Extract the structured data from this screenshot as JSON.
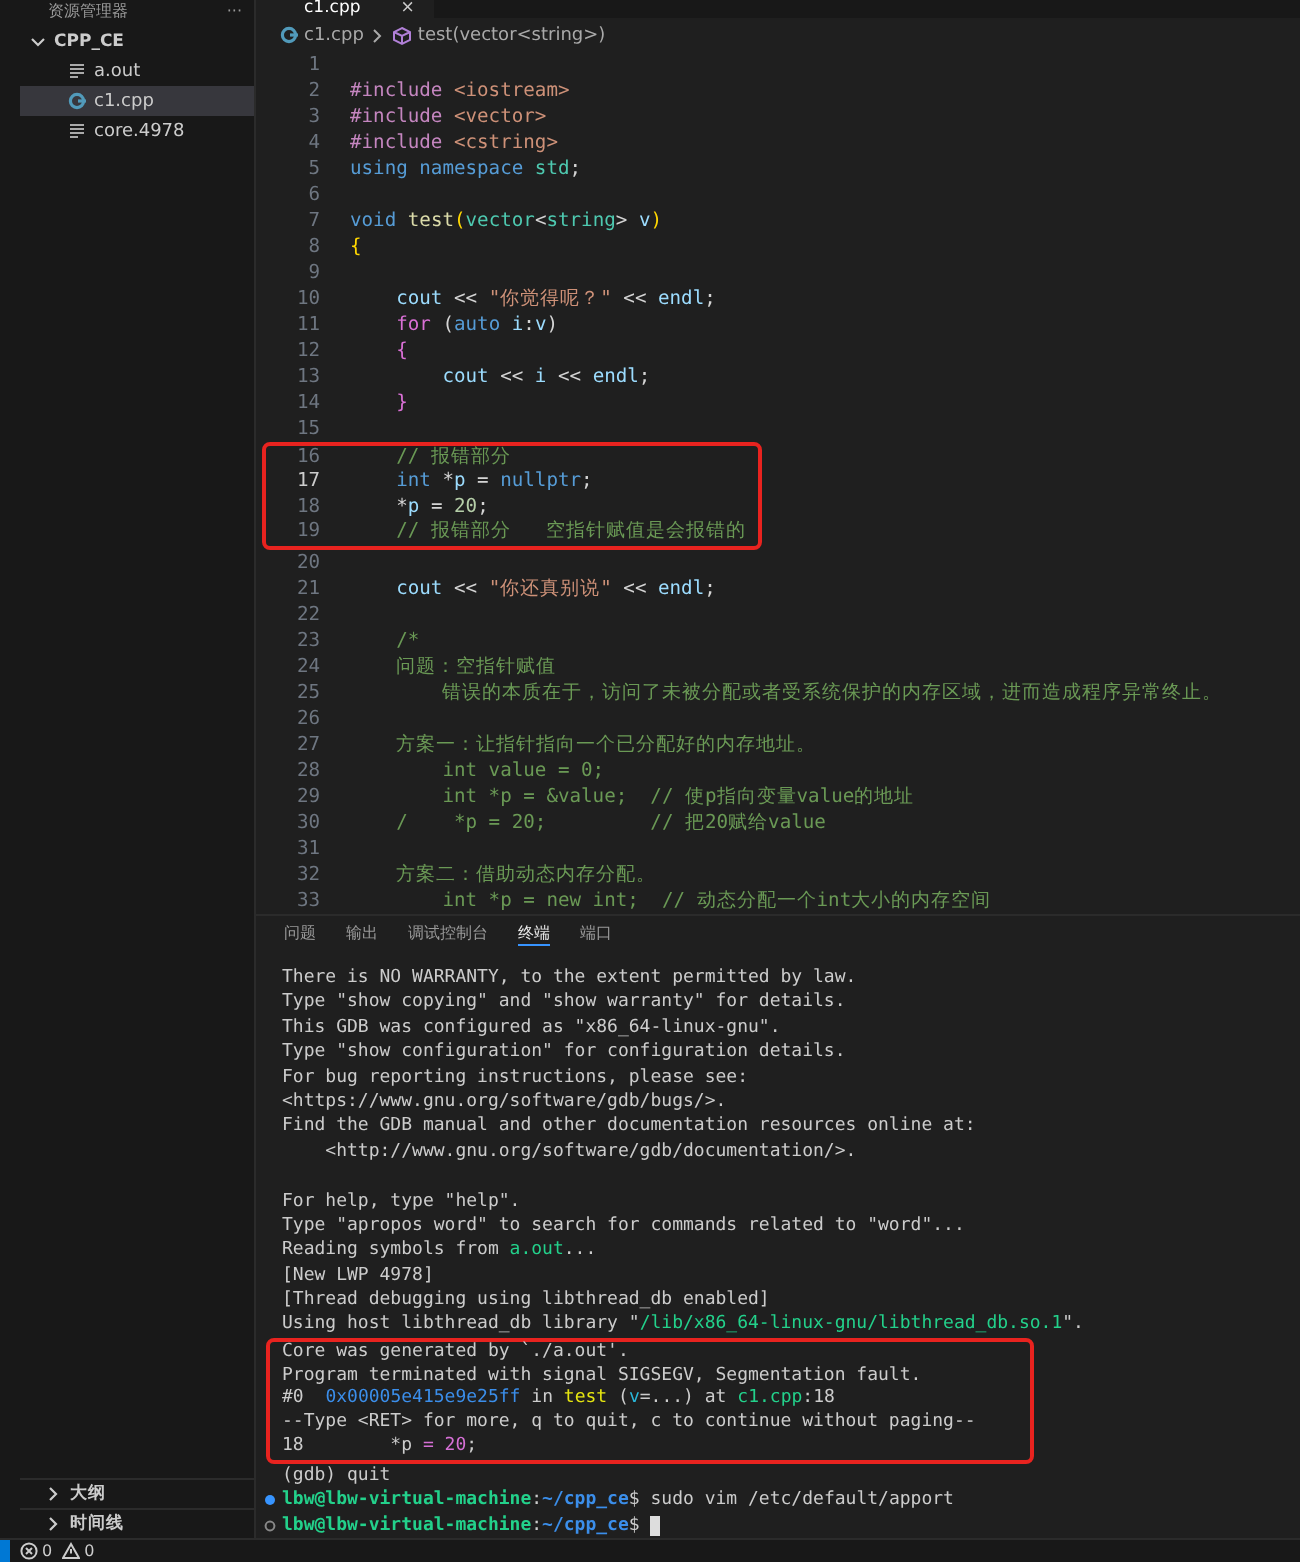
{
  "sidebar": {
    "title": "资源管理器",
    "more": "···",
    "folder": {
      "label": "CPP_CE",
      "expanded": true,
      "children": [
        {
          "label": "a.out",
          "kind": "text",
          "selected": false
        },
        {
          "label": "c1.cpp",
          "kind": "cpp",
          "selected": true
        },
        {
          "label": "core.4978",
          "kind": "text",
          "selected": false
        }
      ]
    },
    "sections": [
      {
        "label": "大纲",
        "expanded": false
      },
      {
        "label": "时间线",
        "expanded": false
      }
    ]
  },
  "editor": {
    "tabs": [
      {
        "label": "c1.cpp",
        "close": "×",
        "selected": true
      }
    ],
    "breadcrumb": [
      {
        "label": "c1.cpp",
        "kind": "file"
      },
      {
        "label": "test(vector<string>)",
        "kind": "function"
      }
    ],
    "lines": [
      {
        "number": "1",
        "boxed": false,
        "current": false
      },
      {
        "number": "2",
        "boxed": false,
        "current": false,
        "tokens": [
          {
            "kind": "macro",
            "text": "#include "
          },
          {
            "kind": "str",
            "text": "<iostream>"
          }
        ]
      },
      {
        "number": "3",
        "boxed": false,
        "current": false,
        "tokens": [
          {
            "kind": "macro",
            "text": "#include "
          },
          {
            "kind": "str",
            "text": "<vector>"
          }
        ]
      },
      {
        "number": "4",
        "boxed": false,
        "current": false,
        "tokens": [
          {
            "kind": "macro",
            "text": "#include "
          },
          {
            "kind": "str",
            "text": "<cstring>"
          }
        ]
      },
      {
        "number": "5",
        "boxed": false,
        "current": false,
        "tokens": [
          {
            "kind": "kw",
            "text": "using "
          },
          {
            "kind": "kw",
            "text": "namespace "
          },
          {
            "kind": "type",
            "text": "std"
          },
          {
            "kind": "plain",
            "text": ";"
          }
        ]
      },
      {
        "number": "6",
        "boxed": false,
        "current": false
      },
      {
        "number": "7",
        "boxed": false,
        "current": false,
        "tokens": [
          {
            "kind": "kw",
            "text": "void "
          },
          {
            "kind": "fn",
            "text": "test"
          },
          {
            "kind": "brace",
            "text": "("
          },
          {
            "kind": "type",
            "text": "vector"
          },
          {
            "kind": "plain",
            "text": "<"
          },
          {
            "kind": "type",
            "text": "string"
          },
          {
            "kind": "plain",
            "text": "> "
          },
          {
            "kind": "var",
            "text": "v"
          },
          {
            "kind": "brace",
            "text": ")"
          }
        ]
      },
      {
        "number": "8",
        "boxed": false,
        "current": false,
        "tokens": [
          {
            "kind": "brace",
            "text": "{"
          }
        ]
      },
      {
        "number": "9",
        "boxed": false,
        "current": false
      },
      {
        "number": "10",
        "boxed": false,
        "current": false,
        "tokens": [
          {
            "kind": "var",
            "text": "    cout"
          },
          {
            "kind": "plain",
            "text": " << "
          },
          {
            "kind": "str",
            "text": "\"你觉得呢？\""
          },
          {
            "kind": "plain",
            "text": " << "
          },
          {
            "kind": "var",
            "text": "endl"
          },
          {
            "kind": "plain",
            "text": ";"
          }
        ]
      },
      {
        "number": "11",
        "boxed": false,
        "current": false,
        "tokens": [
          {
            "kind": "ctrl",
            "text": "    for"
          },
          {
            "kind": "plain",
            "text": " ("
          },
          {
            "kind": "kw",
            "text": "auto "
          },
          {
            "kind": "var",
            "text": "i"
          },
          {
            "kind": "plain",
            "text": ":"
          },
          {
            "kind": "var",
            "text": "v"
          },
          {
            "kind": "plain",
            "text": ")"
          }
        ]
      },
      {
        "number": "12",
        "boxed": false,
        "current": false,
        "tokens": [
          {
            "kind": "ctrl",
            "text": "    {"
          }
        ]
      },
      {
        "number": "13",
        "boxed": false,
        "current": false,
        "tokens": [
          {
            "kind": "var",
            "text": "        cout"
          },
          {
            "kind": "plain",
            "text": " << "
          },
          {
            "kind": "var",
            "text": "i"
          },
          {
            "kind": "plain",
            "text": " << "
          },
          {
            "kind": "var",
            "text": "endl"
          },
          {
            "kind": "plain",
            "text": ";"
          }
        ]
      },
      {
        "number": "14",
        "boxed": false,
        "current": false,
        "tokens": [
          {
            "kind": "ctrl",
            "text": "    }"
          }
        ]
      },
      {
        "number": "15",
        "boxed": false,
        "current": false
      },
      {
        "number": "16",
        "boxed": true,
        "current": false,
        "tokens": [
          {
            "kind": "cmt",
            "text": "    // 报错部分"
          }
        ]
      },
      {
        "number": "17",
        "boxed": true,
        "current": true,
        "tokens": [
          {
            "kind": "kw",
            "text": "    int"
          },
          {
            "kind": "plain",
            "text": " *"
          },
          {
            "kind": "var",
            "text": "p"
          },
          {
            "kind": "plain",
            "text": " = "
          },
          {
            "kind": "kw",
            "text": "nullptr"
          },
          {
            "kind": "plain",
            "text": ";"
          }
        ]
      },
      {
        "number": "18",
        "boxed": true,
        "current": false,
        "tokens": [
          {
            "kind": "plain",
            "text": "    *"
          },
          {
            "kind": "var",
            "text": "p"
          },
          {
            "kind": "plain",
            "text": " = "
          },
          {
            "kind": "num",
            "text": "20"
          },
          {
            "kind": "plain",
            "text": ";"
          }
        ]
      },
      {
        "number": "19",
        "boxed": true,
        "current": false,
        "tokens": [
          {
            "kind": "cmt",
            "text": "    // 报错部分   空指针赋值是会报错的"
          }
        ]
      },
      {
        "number": "20",
        "boxed": false,
        "current": false
      },
      {
        "number": "21",
        "boxed": false,
        "current": false,
        "tokens": [
          {
            "kind": "var",
            "text": "    cout"
          },
          {
            "kind": "plain",
            "text": " << "
          },
          {
            "kind": "str",
            "text": "\"你还真别说\""
          },
          {
            "kind": "plain",
            "text": " << "
          },
          {
            "kind": "var",
            "text": "endl"
          },
          {
            "kind": "plain",
            "text": ";"
          }
        ]
      },
      {
        "number": "22",
        "boxed": false,
        "current": false
      },
      {
        "number": "23",
        "boxed": false,
        "current": false,
        "tokens": [
          {
            "kind": "cmt",
            "text": "    /*"
          }
        ]
      },
      {
        "number": "24",
        "boxed": false,
        "current": false,
        "tokens": [
          {
            "kind": "cmt",
            "text": "    问题：空指针赋值"
          }
        ]
      },
      {
        "number": "25",
        "boxed": false,
        "current": false,
        "tokens": [
          {
            "kind": "cmt",
            "text": "        错误的本质在于，访问了未被分配或者受系统保护的内存区域，进而造成程序异常终止。"
          }
        ]
      },
      {
        "number": "26",
        "boxed": false,
        "current": false
      },
      {
        "number": "27",
        "boxed": false,
        "current": false,
        "tokens": [
          {
            "kind": "cmt",
            "text": "    方案一：让指针指向一个已分配好的内存地址。"
          }
        ]
      },
      {
        "number": "28",
        "boxed": false,
        "current": false,
        "tokens": [
          {
            "kind": "cmt",
            "text": "        int value = 0;"
          }
        ]
      },
      {
        "number": "29",
        "boxed": false,
        "current": false,
        "tokens": [
          {
            "kind": "cmt",
            "text": "        int *p = &value;  // 使p指向变量value的地址"
          }
        ]
      },
      {
        "number": "30",
        "boxed": false,
        "current": false,
        "tokens": [
          {
            "kind": "cmt",
            "text": "    /    *p = 20;         // 把20赋给value"
          }
        ]
      },
      {
        "number": "31",
        "boxed": false,
        "current": false
      },
      {
        "number": "32",
        "boxed": false,
        "current": false,
        "tokens": [
          {
            "kind": "cmt",
            "text": "    方案二：借助动态内存分配。"
          }
        ]
      },
      {
        "number": "33",
        "boxed": false,
        "current": false,
        "tokens": [
          {
            "kind": "cmt",
            "text": "        int *p = new int;  // 动态分配一个int大小的内存空间"
          }
        ]
      }
    ]
  },
  "panel": {
    "tabs": [
      {
        "label": "问题",
        "selected": false
      },
      {
        "label": "输出",
        "selected": false
      },
      {
        "label": "调试控制台",
        "selected": false
      },
      {
        "label": "终端",
        "selected": true
      },
      {
        "label": "端口",
        "selected": false
      }
    ],
    "terminal": [
      {
        "boxed": false,
        "tokens": [
          {
            "kind": "plain",
            "text": "There is NO WARRANTY, to the extent permitted by law."
          }
        ]
      },
      {
        "boxed": false,
        "tokens": [
          {
            "kind": "plain",
            "text": "Type \"show copying\" and \"show warranty\" for details."
          }
        ]
      },
      {
        "boxed": false,
        "tokens": [
          {
            "kind": "plain",
            "text": "This GDB was configured as \"x86_64-linux-gnu\"."
          }
        ]
      },
      {
        "boxed": false,
        "tokens": [
          {
            "kind": "plain",
            "text": "Type \"show configuration\" for configuration details."
          }
        ]
      },
      {
        "boxed": false,
        "tokens": [
          {
            "kind": "plain",
            "text": "For bug reporting instructions, please see:"
          }
        ]
      },
      {
        "boxed": false,
        "tokens": [
          {
            "kind": "plain",
            "text": "<https://www.gnu.org/software/gdb/bugs/>."
          }
        ]
      },
      {
        "boxed": false,
        "tokens": [
          {
            "kind": "plain",
            "text": "Find the GDB manual and other documentation resources online at:"
          }
        ]
      },
      {
        "boxed": false,
        "tokens": [
          {
            "kind": "plain",
            "text": "    <http://www.gnu.org/software/gdb/documentation/>."
          }
        ]
      },
      {
        "boxed": false
      },
      {
        "boxed": false,
        "tokens": [
          {
            "kind": "plain",
            "text": "For help, type \"help\"."
          }
        ]
      },
      {
        "boxed": false,
        "tokens": [
          {
            "kind": "plain",
            "text": "Type \"apropos word\" to search for commands related to \"word\"..."
          }
        ]
      },
      {
        "boxed": false,
        "tokens": [
          {
            "kind": "plain",
            "text": "Reading symbols from "
          },
          {
            "kind": "green",
            "text": "a.out"
          },
          {
            "kind": "plain",
            "text": "..."
          }
        ]
      },
      {
        "boxed": false,
        "tokens": [
          {
            "kind": "plain",
            "text": "[New LWP 4978]"
          }
        ]
      },
      {
        "boxed": false,
        "tokens": [
          {
            "kind": "plain",
            "text": "[Thread debugging using libthread_db enabled]"
          }
        ]
      },
      {
        "boxed": false,
        "tokens": [
          {
            "kind": "plain",
            "text": "Using host libthread_db library \""
          },
          {
            "kind": "green",
            "text": "/lib/x86_64-linux-gnu/libthread_db.so.1"
          },
          {
            "kind": "plain",
            "text": "\"."
          }
        ]
      },
      {
        "boxed": true,
        "tokens": [
          {
            "kind": "plain",
            "text": "Core was generated by `./a.out'."
          }
        ]
      },
      {
        "boxed": true,
        "tokens": [
          {
            "kind": "plain",
            "text": "Program terminated with signal SIGSEGV, Segmentation fault."
          }
        ]
      },
      {
        "boxed": true,
        "tokens": [
          {
            "kind": "plain",
            "text": "#0  "
          },
          {
            "kind": "blue",
            "text": "0x00005e415e9e25ff"
          },
          {
            "kind": "plain",
            "text": " in "
          },
          {
            "kind": "yellow",
            "text": "test"
          },
          {
            "kind": "plain",
            "text": " ("
          },
          {
            "kind": "cyan",
            "text": "v"
          },
          {
            "kind": "plain",
            "text": "=...) at "
          },
          {
            "kind": "green",
            "text": "c1.cpp"
          },
          {
            "kind": "plain",
            "text": ":18"
          }
        ]
      },
      {
        "boxed": true,
        "tokens": [
          {
            "kind": "plain",
            "text": "--Type <RET> for more, q to quit, c to continue without paging--"
          }
        ]
      },
      {
        "boxed": true,
        "tokens": [
          {
            "kind": "plain",
            "text": "18        *p "
          },
          {
            "kind": "purple",
            "text": "="
          },
          {
            "kind": "purple",
            "text": " 20"
          },
          {
            "kind": "plain",
            "text": ";"
          }
        ]
      },
      {
        "boxed": false,
        "tokens": [
          {
            "kind": "plain",
            "text": "(gdb) quit"
          }
        ]
      },
      {
        "boxed": false,
        "command_done": true,
        "tokens": [
          {
            "kind": "prompt",
            "text": "lbw@lbw-virtual-machine"
          },
          {
            "kind": "plain",
            "text": ":"
          },
          {
            "kind": "path",
            "text": "~/cpp_ce"
          },
          {
            "kind": "plain",
            "text": "$ sudo vim /etc/default/apport"
          }
        ]
      },
      {
        "boxed": false,
        "command_done": false,
        "cursor": true,
        "tokens": [
          {
            "kind": "prompt",
            "text": "lbw@lbw-virtual-machine"
          },
          {
            "kind": "plain",
            "text": ":"
          },
          {
            "kind": "path",
            "text": "~/cpp_ce"
          },
          {
            "kind": "plain",
            "text": "$"
          }
        ]
      }
    ]
  },
  "status_bar": {
    "errors": "0",
    "warnings": "0"
  }
}
